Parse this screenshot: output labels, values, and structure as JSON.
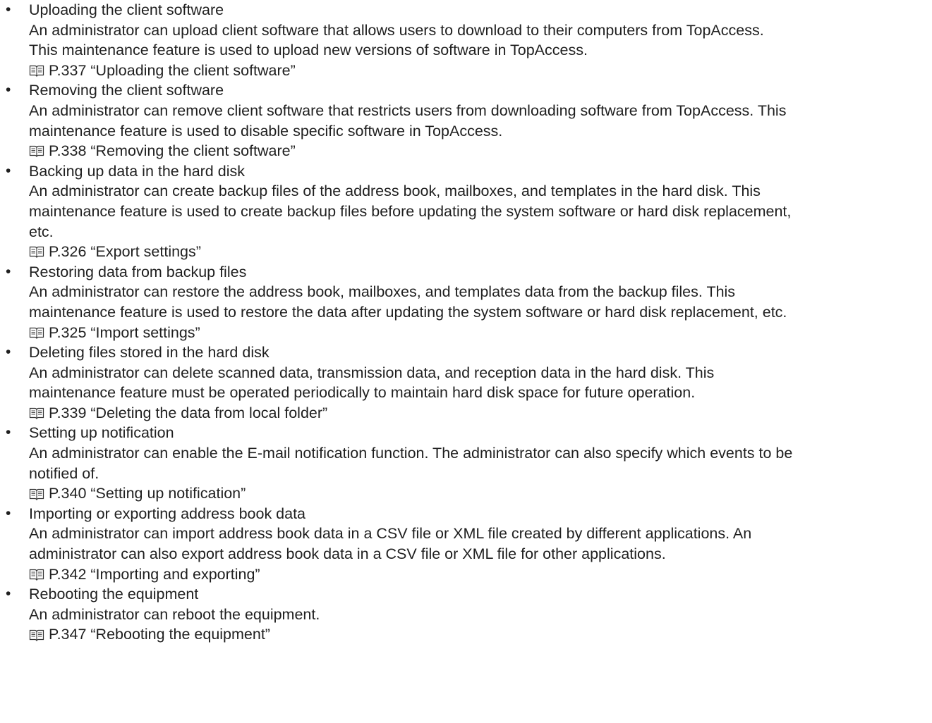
{
  "features": [
    {
      "heading": "Uploading the client software",
      "lines": [
        "An administrator can upload client software that allows users to download to their computers from TopAccess.",
        "This maintenance feature is used to upload new versions of software in TopAccess."
      ],
      "ref": "P.337 “Uploading the client software”",
      "ref_icon": "book-icon"
    },
    {
      "heading": "Removing the client software",
      "lines": [
        "An administrator can remove client software that restricts users from downloading software from TopAccess. This",
        "maintenance feature is used to disable specific software in TopAccess."
      ],
      "ref": "P.338 “Removing the client software”",
      "ref_icon": "book-icon"
    },
    {
      "heading": "Backing up data in the hard disk",
      "lines": [
        "An administrator can create backup files of the address book, mailboxes, and templates in the hard disk. This",
        "maintenance feature is used to create backup files before updating the system software or hard disk replacement,",
        "etc."
      ],
      "ref": "P.326 “Export settings”",
      "ref_icon": "book-icon"
    },
    {
      "heading": "Restoring data from backup files",
      "lines": [
        "An administrator can restore the address book, mailboxes, and templates data from the backup files. This",
        "maintenance feature is used to restore the data after updating the system software or hard disk replacement, etc."
      ],
      "ref": "P.325 “Import settings”",
      "ref_icon": "book-icon"
    },
    {
      "heading": "Deleting files stored in the hard disk",
      "lines": [
        "An administrator can delete scanned data, transmission data, and reception data in the hard disk. This",
        "maintenance feature must be operated periodically to maintain hard disk space for future operation."
      ],
      "ref": "P.339 “Deleting the data from local folder”",
      "ref_icon": "book-icon"
    },
    {
      "heading": "Setting up notification",
      "lines": [
        "An administrator can enable the E-mail notification function. The administrator can also specify which events to be",
        "notified of."
      ],
      "ref": "P.340 “Setting up notification”",
      "ref_icon": "book-icon"
    },
    {
      "heading": "Importing or exporting address book data",
      "lines": [
        "An administrator can import address book data in a CSV file or XML file created by different applications. An",
        "administrator can also export address book data in a CSV file or XML file for other applications."
      ],
      "ref": "P.342 “Importing and exporting”",
      "ref_icon": "book-icon"
    },
    {
      "heading": "Rebooting the equipment",
      "lines": [
        "An administrator can reboot the equipment."
      ],
      "ref": "P.347 “Rebooting the equipment”",
      "ref_icon": "book-icon"
    }
  ],
  "colors": {
    "text": "#1f1f1f",
    "background": "#ffffff"
  }
}
